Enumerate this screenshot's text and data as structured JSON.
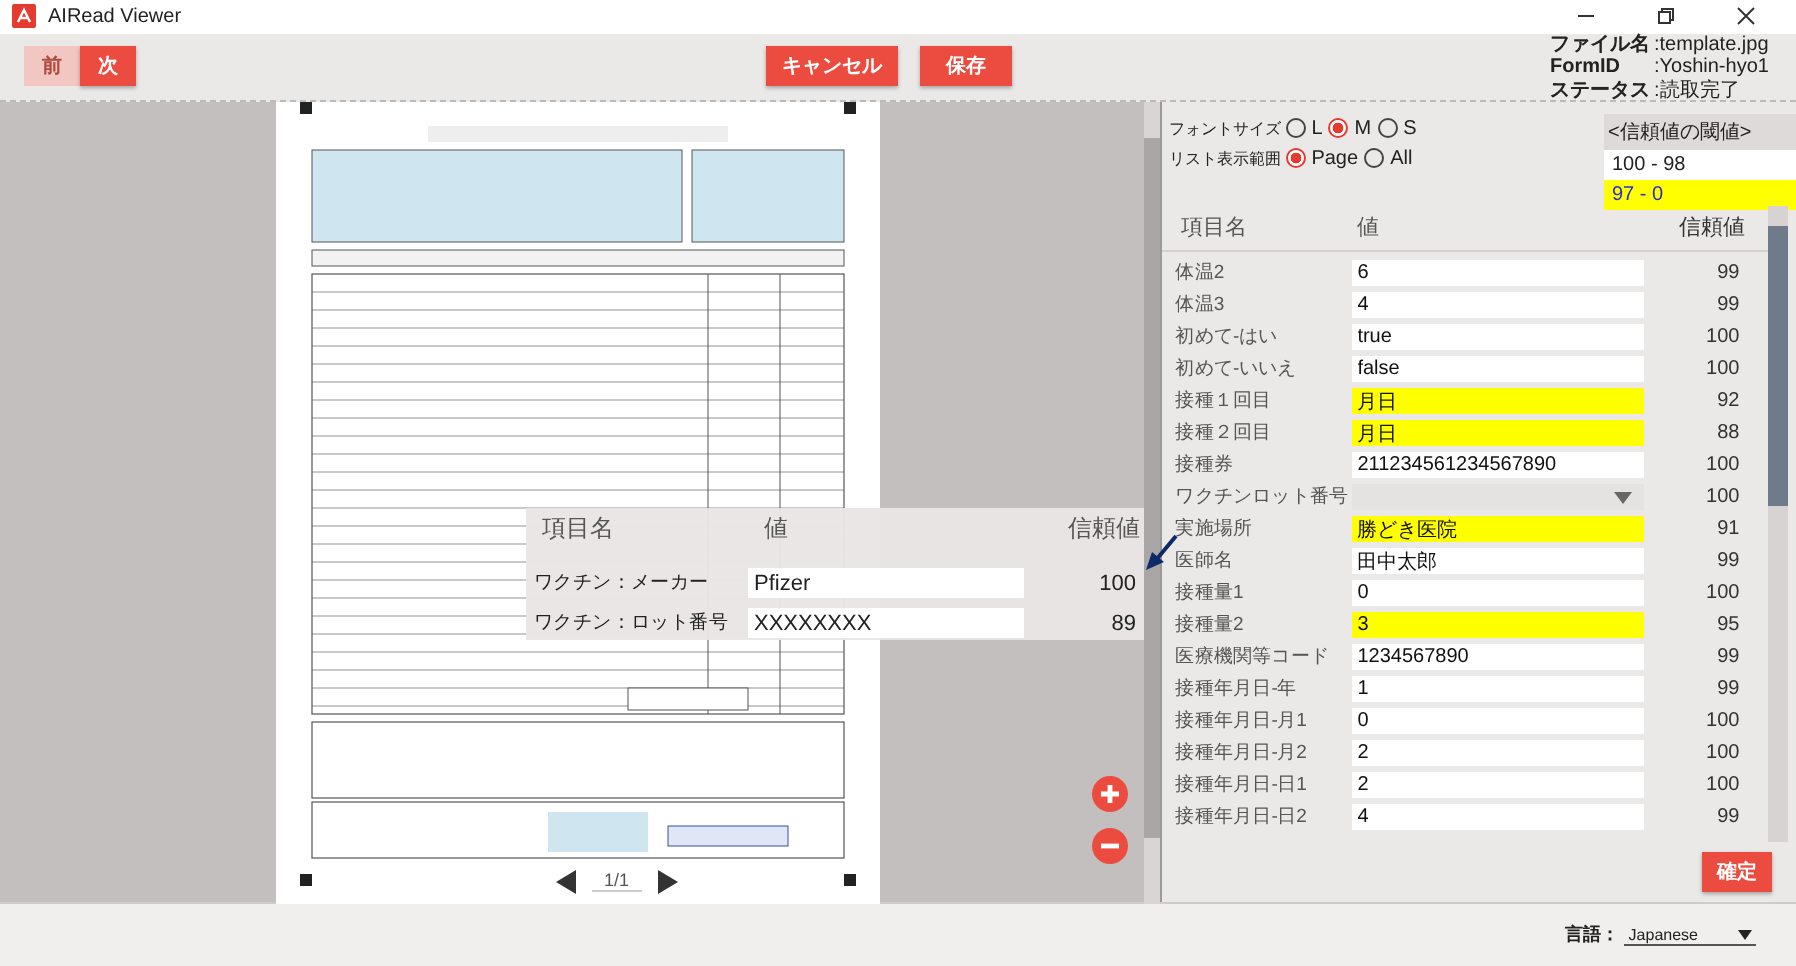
{
  "window": {
    "title": "AIRead Viewer"
  },
  "toolbar": {
    "nav": [
      {
        "label": "前",
        "disabled": true
      },
      {
        "label": "次",
        "disabled": false
      }
    ],
    "actions": [
      "キャンセル",
      "保存"
    ]
  },
  "info": [
    {
      "label": "ファイル名",
      "value": ":template.jpg"
    },
    {
      "label": "FormID",
      "value": ":Yoshin-hyo1"
    },
    {
      "label": "ステータス",
      "value": ":読取完了"
    }
  ],
  "document": {
    "page": "1/1"
  },
  "popup": {
    "columns": [
      "項目名",
      "値",
      "信頼値"
    ],
    "rows": [
      {
        "name": "ワクチン：メーカー",
        "value": "Pfizer",
        "confidence": "100"
      },
      {
        "name": "ワクチン：ロット番号",
        "value": "XXXXXXXX",
        "confidence": "89"
      }
    ]
  },
  "options": [
    {
      "label": "フォントサイズ",
      "choices": [
        {
          "label": "L",
          "selected": false
        },
        {
          "label": "M",
          "selected": true
        },
        {
          "label": "S",
          "selected": false
        }
      ]
    },
    {
      "label": "リスト表示範囲",
      "choices": [
        {
          "label": "Page",
          "selected": true
        },
        {
          "label": "All",
          "selected": false
        }
      ]
    }
  ],
  "threshold": {
    "title": "<信頼値の閾値>",
    "bands": [
      {
        "label": "100 - 98",
        "color": "#ffffff"
      },
      {
        "label": "97 - 0",
        "color": "#ffff00"
      }
    ]
  },
  "table": {
    "columns": [
      "項目名",
      "値",
      "信頼値"
    ],
    "rows": [
      {
        "name": "体温2",
        "value": "6",
        "confidence": "99",
        "low": false,
        "kind": "text"
      },
      {
        "name": "体温3",
        "value": "4",
        "confidence": "99",
        "low": false,
        "kind": "text"
      },
      {
        "name": "初めて-はい",
        "value": "true",
        "confidence": "100",
        "low": false,
        "kind": "text"
      },
      {
        "name": "初めて-いいえ",
        "value": "false",
        "confidence": "100",
        "low": false,
        "kind": "text"
      },
      {
        "name": "接種１回目",
        "value": "月日",
        "confidence": "92",
        "low": true,
        "kind": "text"
      },
      {
        "name": "接種２回目",
        "value": "月日",
        "confidence": "88",
        "low": true,
        "kind": "text"
      },
      {
        "name": "接種券",
        "value": "211234561234567890",
        "confidence": "100",
        "low": false,
        "kind": "text"
      },
      {
        "name": "ワクチンロット番号",
        "value": "",
        "confidence": "100",
        "low": false,
        "kind": "select"
      },
      {
        "name": "実施場所",
        "value": "勝どき医院",
        "confidence": "91",
        "low": true,
        "kind": "text"
      },
      {
        "name": "医師名",
        "value": "田中太郎",
        "confidence": "99",
        "low": false,
        "kind": "text"
      },
      {
        "name": "接種量1",
        "value": "0",
        "confidence": "100",
        "low": false,
        "kind": "text"
      },
      {
        "name": "接種量2",
        "value": "3",
        "confidence": "95",
        "low": true,
        "kind": "text"
      },
      {
        "name": "医療機関等コード",
        "value": "1234567890",
        "confidence": "99",
        "low": false,
        "kind": "text"
      },
      {
        "name": "接種年月日-年",
        "value": "1",
        "confidence": "99",
        "low": false,
        "kind": "text"
      },
      {
        "name": "接種年月日-月1",
        "value": "0",
        "confidence": "100",
        "low": false,
        "kind": "text"
      },
      {
        "name": "接種年月日-月2",
        "value": "2",
        "confidence": "100",
        "low": false,
        "kind": "text"
      },
      {
        "name": "接種年月日-日1",
        "value": "2",
        "confidence": "100",
        "low": false,
        "kind": "text"
      },
      {
        "name": "接種年月日-日2",
        "value": "4",
        "confidence": "99",
        "low": false,
        "kind": "text"
      }
    ]
  },
  "confirm": "確定",
  "language": {
    "label": "言語：",
    "value": "Japanese"
  }
}
